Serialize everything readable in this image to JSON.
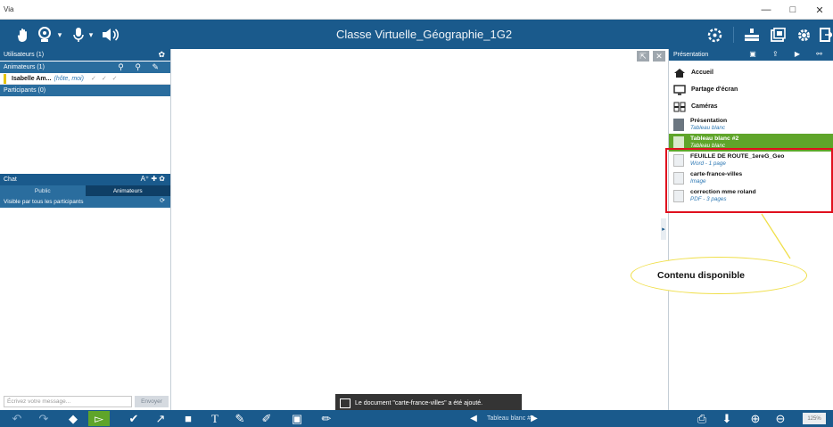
{
  "window": {
    "app_title": "Via",
    "minimize": "—",
    "maximize": "□",
    "close": "✕"
  },
  "topbar": {
    "title": "Classe Virtuelle_Géographie_1G2"
  },
  "left": {
    "users_header": "Utilisateurs (1)",
    "animators_header": "Animateurs (1)",
    "user": {
      "name": "Isabelle Am...",
      "role": "(hôte, moi)"
    },
    "participants_header": "Participants (0)",
    "chat_header": "Chat",
    "chat_header_icons": "A⁺ ✚ ✿",
    "tabs": [
      {
        "label": "Public"
      },
      {
        "label": "Animateurs"
      }
    ],
    "visibility": "Visible par tous les participants",
    "chat_placeholder": "Écrivez votre message...",
    "send_label": "Envoyer"
  },
  "right": {
    "header": "Présentation",
    "items": [
      {
        "label": "Accueil",
        "icon": "home-icon"
      },
      {
        "label": "Partage d'écran",
        "icon": "monitor-icon"
      },
      {
        "label": "Caméras",
        "icon": "cameras-icon"
      }
    ],
    "docs": [
      {
        "title": "Présentation",
        "subtitle": "Tableau blanc"
      },
      {
        "title": "Tableau blanc #2",
        "subtitle": "Tableau blanc"
      },
      {
        "title": "FEUILLE DE ROUTE_1ereG_Geo",
        "subtitle": "Word - 1 page"
      },
      {
        "title": "carte-france-villes",
        "subtitle": "Image"
      },
      {
        "title": "correction mme roland",
        "subtitle": "PDF - 3 pages"
      }
    ]
  },
  "annotation": {
    "text": "Contenu disponible"
  },
  "toast": {
    "text": "Le document \"carte-france-villes\" a été ajouté."
  },
  "bottombar": {
    "page_label": "Tableau blanc #2",
    "zoom": "125%"
  },
  "colors": {
    "primary": "#1a5a8c",
    "selected": "#5fa52a",
    "highlight": "#e0101e",
    "callout": "#f0df4a"
  }
}
